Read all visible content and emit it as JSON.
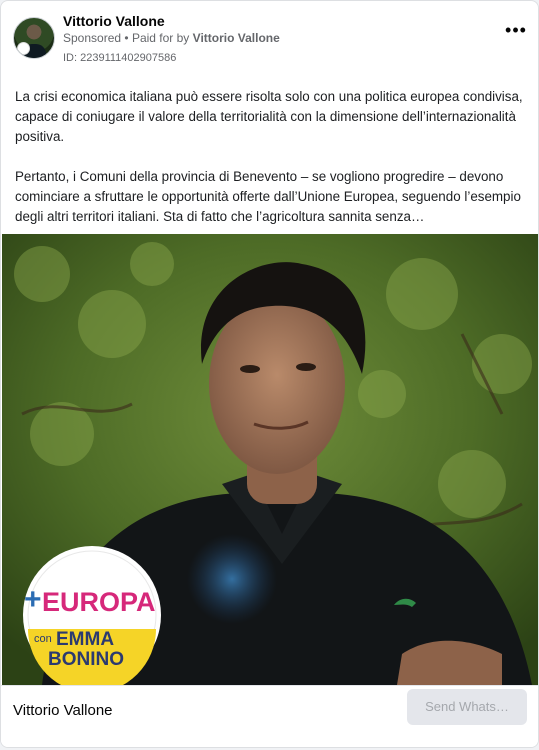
{
  "header": {
    "page_name": "Vittorio Vallone",
    "sponsored": "Sponsored",
    "separator": "•",
    "paid_for_prefix": "Paid for by",
    "paid_for_name": "Vittorio Vallone",
    "ad_id": "ID: 2239111402907586",
    "more_icon": "more-horizontal-icon"
  },
  "post": {
    "paragraph_1": "La crisi economica italiana può essere risolta solo con una politica europea condivisa, capace di coniugare il valore della territorialità con la dimensione dell’internazionalità positiva.",
    "paragraph_2": "Pertanto, i Comuni della provincia di Benevento – se vogliono progredire – devono cominciare a sfruttare le opportunità offerte dall’Unione Europea, seguendo l’esempio degli altri territori italiani. Sta di fatto che l’agricoltura sannita senza…"
  },
  "media": {
    "logo_text_main": "EUROPA",
    "logo_text_con": "con",
    "logo_text_name1": "EMMA",
    "logo_text_name2": "BONINO",
    "brand_shirt_logo": "crocodile-logo"
  },
  "footer": {
    "title": "Vittorio Vallone",
    "cta_label": "Send Whats…"
  },
  "colors": {
    "logo_yellow": "#f5d427",
    "logo_magenta": "#d6287a",
    "logo_blue": "#2b6cb3",
    "muted_text": "#65676b"
  }
}
